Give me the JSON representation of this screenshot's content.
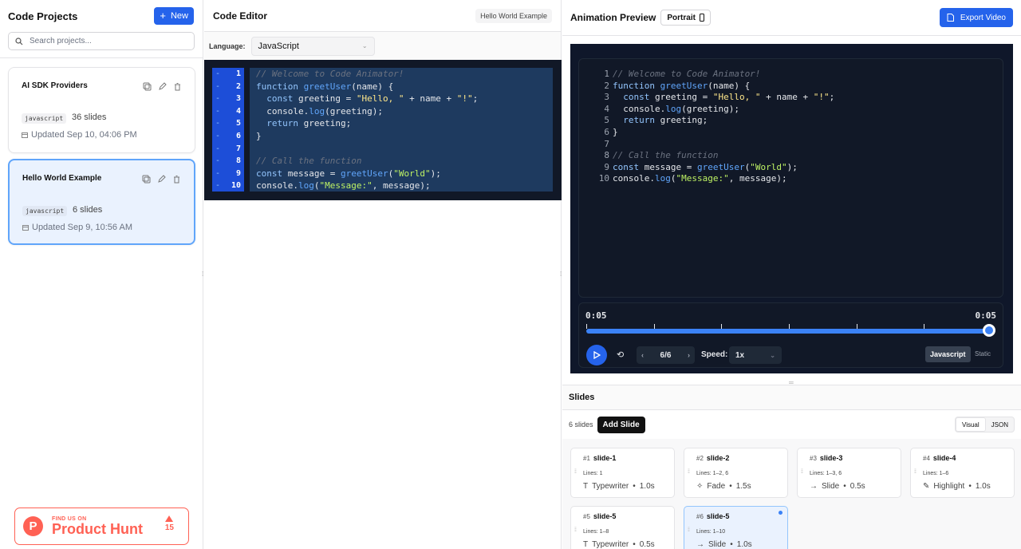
{
  "left": {
    "title": "Code Projects",
    "new_label": "New",
    "search_placeholder": "Search projects...",
    "projects": [
      {
        "name": "AI SDK Providers",
        "language": "javascript",
        "slides": "36 slides",
        "updated": "Updated Sep 10, 04:06 PM"
      },
      {
        "name": "Hello World Example",
        "language": "javascript",
        "slides": "6 slides",
        "updated": "Updated Sep 9, 10:56 AM"
      }
    ],
    "product_hunt": {
      "small": "FIND US ON",
      "big": "Product Hunt",
      "votes": "15",
      "logo": "P"
    }
  },
  "editor": {
    "title": "Code Editor",
    "project_tag": "Hello World Example",
    "language_label": "Language:",
    "language_value": "JavaScript",
    "line_numbers": [
      "1",
      "2",
      "3",
      "4",
      "5",
      "6",
      "7",
      "8",
      "9",
      "10"
    ]
  },
  "code_lines": [
    [
      [
        "c-comment",
        "// Welcome to Code Animator!"
      ]
    ],
    [
      [
        "c-kw",
        "function "
      ],
      [
        "c-fn",
        "greetUser"
      ],
      [
        "c-plain",
        "(name) {"
      ]
    ],
    [
      [
        "c-plain",
        "  "
      ],
      [
        "c-kw",
        "const "
      ],
      [
        "c-plain",
        "greeting = "
      ],
      [
        "c-str",
        "\"Hello, \""
      ],
      [
        "c-plain",
        " + name + "
      ],
      [
        "c-str",
        "\"!\""
      ],
      [
        "c-plain",
        ";"
      ]
    ],
    [
      [
        "c-plain",
        "  console."
      ],
      [
        "c-fn",
        "log"
      ],
      [
        "c-plain",
        "(greeting);"
      ]
    ],
    [
      [
        "c-plain",
        "  "
      ],
      [
        "c-kw",
        "return "
      ],
      [
        "c-plain",
        "greeting;"
      ]
    ],
    [
      [
        "c-plain",
        "}"
      ]
    ],
    [
      [
        "c-plain",
        ""
      ]
    ],
    [
      [
        "c-comment",
        "// Call the function"
      ]
    ],
    [
      [
        "c-kw",
        "const "
      ],
      [
        "c-plain",
        "message = "
      ],
      [
        "c-fn",
        "greetUser"
      ],
      [
        "c-plain",
        "("
      ],
      [
        "c-str2",
        "\"World\""
      ],
      [
        "c-plain",
        ");"
      ]
    ],
    [
      [
        "c-plain",
        "console."
      ],
      [
        "c-fn",
        "log"
      ],
      [
        "c-plain",
        "("
      ],
      [
        "c-str2",
        "\"Message:\""
      ],
      [
        "c-plain",
        ", message);"
      ]
    ]
  ],
  "preview": {
    "title": "Animation Preview",
    "orientation": "Portrait",
    "export_label": "Export Video",
    "time_start": "0:05",
    "time_end": "0:05",
    "progress": 1.0,
    "tick_count": 6,
    "pager": "6/6",
    "speed_label": "Speed:",
    "speed_value": "1x",
    "mode_active": "Javascript",
    "mode_other": "Static"
  },
  "slides_panel": {
    "title": "Slides",
    "count": "6 slides",
    "add_label": "Add Slide",
    "view_visual": "Visual",
    "view_json": "JSON",
    "slides": [
      {
        "num": "#1",
        "name": "slide-1",
        "lines": "Lines: 1",
        "transition": "Typewriter",
        "duration": "1.0s",
        "icon": "T"
      },
      {
        "num": "#2",
        "name": "slide-2",
        "lines": "Lines: 1–2, 6",
        "transition": "Fade",
        "duration": "1.5s",
        "icon": "✧"
      },
      {
        "num": "#3",
        "name": "slide-3",
        "lines": "Lines: 1–3, 6",
        "transition": "Slide",
        "duration": "0.5s",
        "icon": "→"
      },
      {
        "num": "#4",
        "name": "slide-4",
        "lines": "Lines: 1–6",
        "transition": "Highlight",
        "duration": "1.0s",
        "icon": "✎"
      },
      {
        "num": "#5",
        "name": "slide-5",
        "lines": "Lines: 1–8",
        "transition": "Typewriter",
        "duration": "0.5s",
        "icon": "T"
      },
      {
        "num": "#6",
        "name": "slide-5",
        "lines": "Lines: 1–10",
        "transition": "Slide",
        "duration": "1.0s",
        "icon": "→"
      }
    ]
  },
  "colors": {
    "accent": "#2563eb",
    "product_hunt": "#ff6154",
    "editor_bg": "#111827"
  }
}
